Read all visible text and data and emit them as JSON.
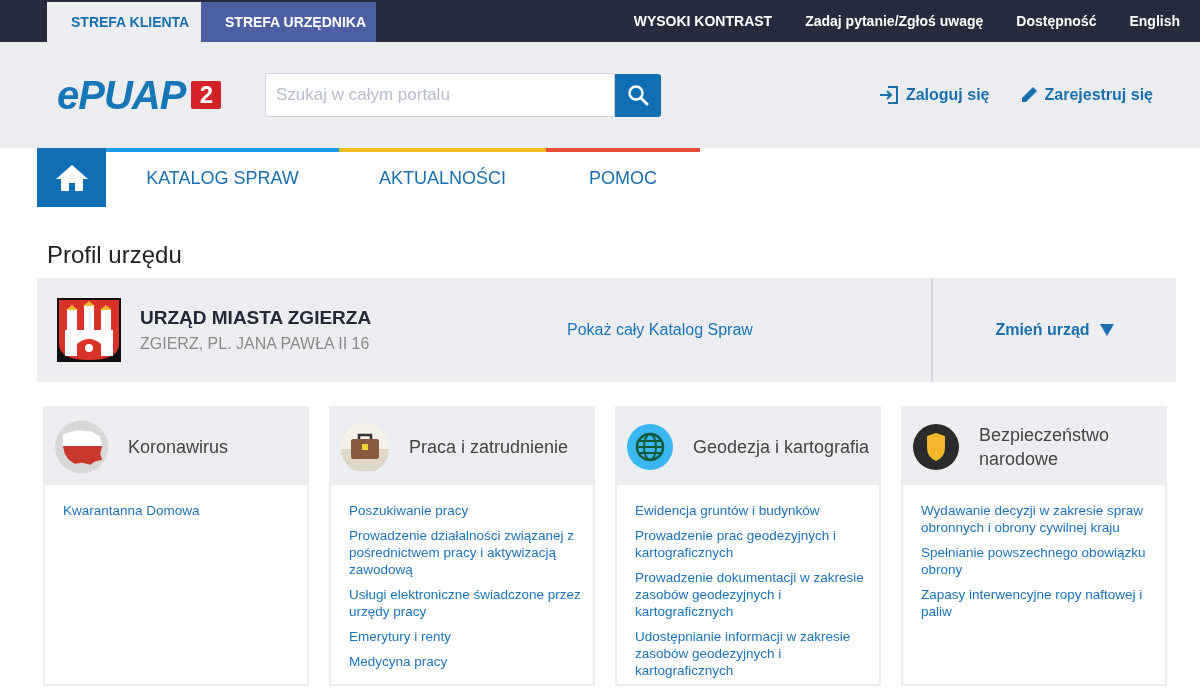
{
  "top_tabs": [
    {
      "label": "STREFA KLIENTA",
      "selected": true
    },
    {
      "label": "STREFA URZĘDNIKA",
      "selected": false
    }
  ],
  "top_links": [
    "WYSOKI KONTRAST",
    "Zadaj pytanie/Zgłoś uwagę",
    "Dostępność",
    "English"
  ],
  "logo": {
    "text": "ePUAP",
    "badge": "2"
  },
  "search": {
    "placeholder": "Szukaj w całym portalu"
  },
  "account_links": [
    {
      "kind": "login",
      "label": "Zaloguj się"
    },
    {
      "kind": "register",
      "label": "Zarejestruj się"
    }
  ],
  "nav": [
    {
      "label": "KATALOG SPRAW",
      "color": "#1a9be6"
    },
    {
      "label": "AKTUALNOŚCI",
      "color": "#f0c020"
    },
    {
      "label": "POMOC",
      "color": "#e8493a"
    }
  ],
  "page_title": "Profil urzędu",
  "office": {
    "name": "URZĄD MIASTA ZGIERZA",
    "address": "ZGIERZ, PL. JANA PAWŁA II 16",
    "catalog_link": "Pokaż cały Katalog Spraw",
    "change": "Zmień urząd"
  },
  "categories": [
    {
      "kind": "map",
      "title": "Koronawirus",
      "links": [
        "Kwarantanna Domowa"
      ]
    },
    {
      "kind": "briefcase",
      "title": "Praca i zatrudnienie",
      "links": [
        "Poszukiwanie pracy",
        "Prowadzenie działalności związanej z pośrednictwem pracy i aktywizacją zawodową",
        "Usługi elektroniczne świadczone przez urzędy pracy",
        "Emerytury i renty",
        "Medycyna pracy"
      ]
    },
    {
      "kind": "globe",
      "title": "Geodezja i kartografia",
      "links": [
        "Ewidencja gruntów i budynków",
        "Prowadzenie prac geodezyjnych i kartograficznych",
        "Prowadzenie dokumentacji w zakresie zasobów geodezyjnych i kartograficznych",
        "Udostępnianie informacji w zakresie zasobów geodezyjnych i kartograficznych"
      ]
    },
    {
      "kind": "shield",
      "title": "Bezpieczeństwo narodowe",
      "links": [
        "Wydawanie decyzji w zakresie spraw obronnych i obrony cywilnej kraju",
        "Spełnianie powszechnego obowiązku obrony",
        "Zapasy interwencyjne ropy naftowej i paliw"
      ]
    }
  ]
}
